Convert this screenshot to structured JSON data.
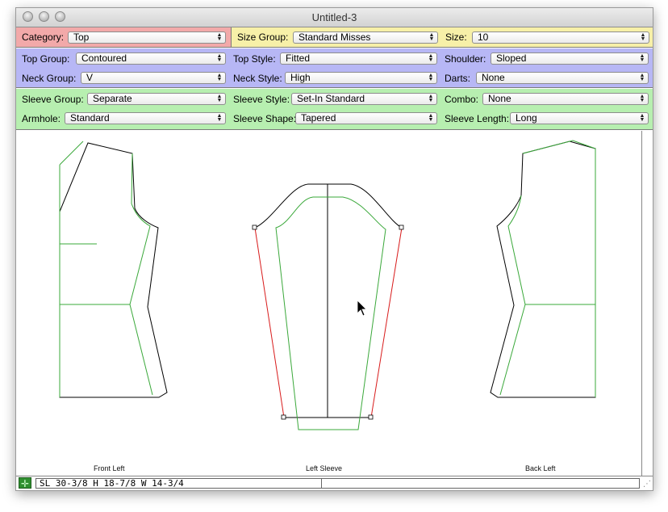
{
  "window": {
    "title": "Untitled-3"
  },
  "row1": {
    "category": {
      "label": "Category:",
      "value": "Top"
    },
    "size_group": {
      "label": "Size Group:",
      "value": "Standard Misses"
    },
    "size": {
      "label": "Size:",
      "value": "10"
    }
  },
  "row2": {
    "top_group": {
      "label": "Top Group:",
      "value": "Contoured"
    },
    "top_style": {
      "label": "Top Style:",
      "value": "Fitted"
    },
    "shoulder": {
      "label": "Shoulder:",
      "value": "Sloped"
    },
    "neck_group": {
      "label": "Neck Group:",
      "value": "V"
    },
    "neck_style": {
      "label": "Neck Style:",
      "value": "High"
    },
    "darts": {
      "label": "Darts:",
      "value": "None"
    }
  },
  "row3": {
    "sleeve_group": {
      "label": "Sleeve Group:",
      "value": "Separate"
    },
    "sleeve_style": {
      "label": "Sleeve Style:",
      "value": "Set-In Standard"
    },
    "combo": {
      "label": "Combo:",
      "value": "None"
    },
    "armhole": {
      "label": "Armhole:",
      "value": "Standard"
    },
    "sleeve_shape": {
      "label": "Sleeve Shape:",
      "value": "Tapered"
    },
    "sleeve_length": {
      "label": "Sleeve Length:",
      "value": "Long"
    }
  },
  "pieces": {
    "front_left": "Front Left",
    "left_sleeve": "Left Sleeve",
    "back_left": "Back Left"
  },
  "status": {
    "measurements": "SL 30-3/8  H 18-7/8  W 14-3/4"
  },
  "colors": {
    "row1_pink": "#f2a9a9",
    "row1_yellow": "#f7f0a8",
    "row2_blue": "#b7b7f5",
    "row3_green": "#b7efb0",
    "outline": "#000000",
    "seam_green": "#3aa83a",
    "selected_red": "#d81b1b"
  },
  "icons": {
    "popup_arrows": "updown-arrows-icon",
    "status_button": "crosshair-icon",
    "resize": "resize-grip-icon"
  }
}
